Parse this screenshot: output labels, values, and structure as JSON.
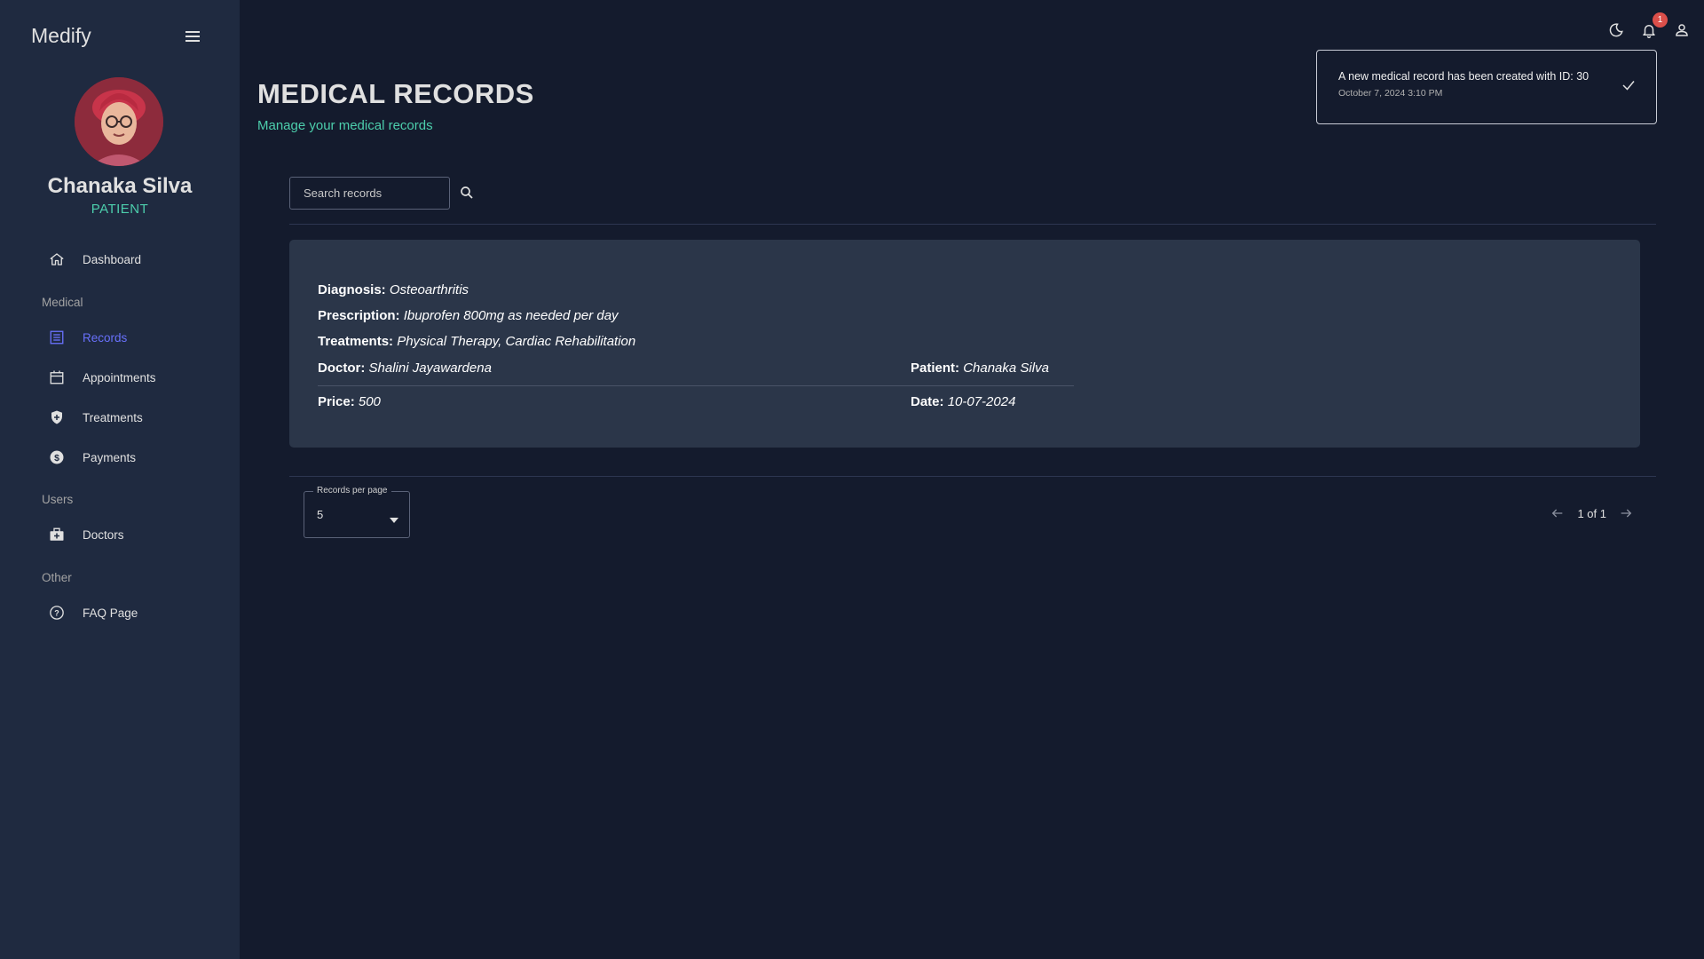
{
  "app": {
    "brand": "Medify"
  },
  "profile": {
    "name": "Chanaka Silva",
    "role": "PATIENT"
  },
  "sidebar": {
    "items": [
      {
        "label": "Dashboard"
      },
      {
        "label": "Records"
      },
      {
        "label": "Appointments"
      },
      {
        "label": "Treatments"
      },
      {
        "label": "Payments"
      },
      {
        "label": "Doctors"
      },
      {
        "label": "FAQ Page"
      }
    ],
    "sections": [
      "Medical",
      "Users",
      "Other"
    ],
    "active": "Records"
  },
  "topbar": {
    "notification_count": "1"
  },
  "notification": {
    "message": "A new medical record has been created with ID: 30",
    "time": "October 7, 2024 3:10 PM"
  },
  "header": {
    "title": "MEDICAL RECORDS",
    "subtitle": "Manage your medical records"
  },
  "search": {
    "placeholder": "Search records",
    "value": ""
  },
  "record": {
    "diagnosis_label": "Diagnosis:",
    "diagnosis": "Osteoarthritis",
    "prescription_label": "Prescription:",
    "prescription": "Ibuprofen 800mg as needed per day",
    "treatments_label": "Treatments:",
    "treatments": "Physical Therapy, Cardiac Rehabilitation",
    "doctor_label": "Doctor:",
    "doctor": "Shalini Jayawardena",
    "patient_label": "Patient:",
    "patient": "Chanaka Silva",
    "price_label": "Price:",
    "price": "500",
    "date_label": "Date:",
    "date": "10-07-2024"
  },
  "pagination": {
    "per_page_label": "Records per page",
    "per_page_value": "5",
    "page_info": "1 of 1"
  },
  "colors": {
    "background": "#141b2d",
    "sidebar": "#1f2a40",
    "card": "#2b3649",
    "accent_green": "#4cceac",
    "accent_blue": "#6870fa",
    "badge_red": "#db4f4a"
  },
  "icons": {
    "menu": "hamburger-icon",
    "dashboard": "home-icon",
    "records": "list-icon",
    "appointments": "calendar-icon",
    "treatments": "shield-icon",
    "payments": "dollar-icon",
    "doctors": "medical-bag-icon",
    "faq": "help-circle-icon",
    "theme": "moon-icon",
    "notifications": "bell-icon",
    "profile": "person-icon",
    "search": "search-icon",
    "check": "check-icon"
  }
}
